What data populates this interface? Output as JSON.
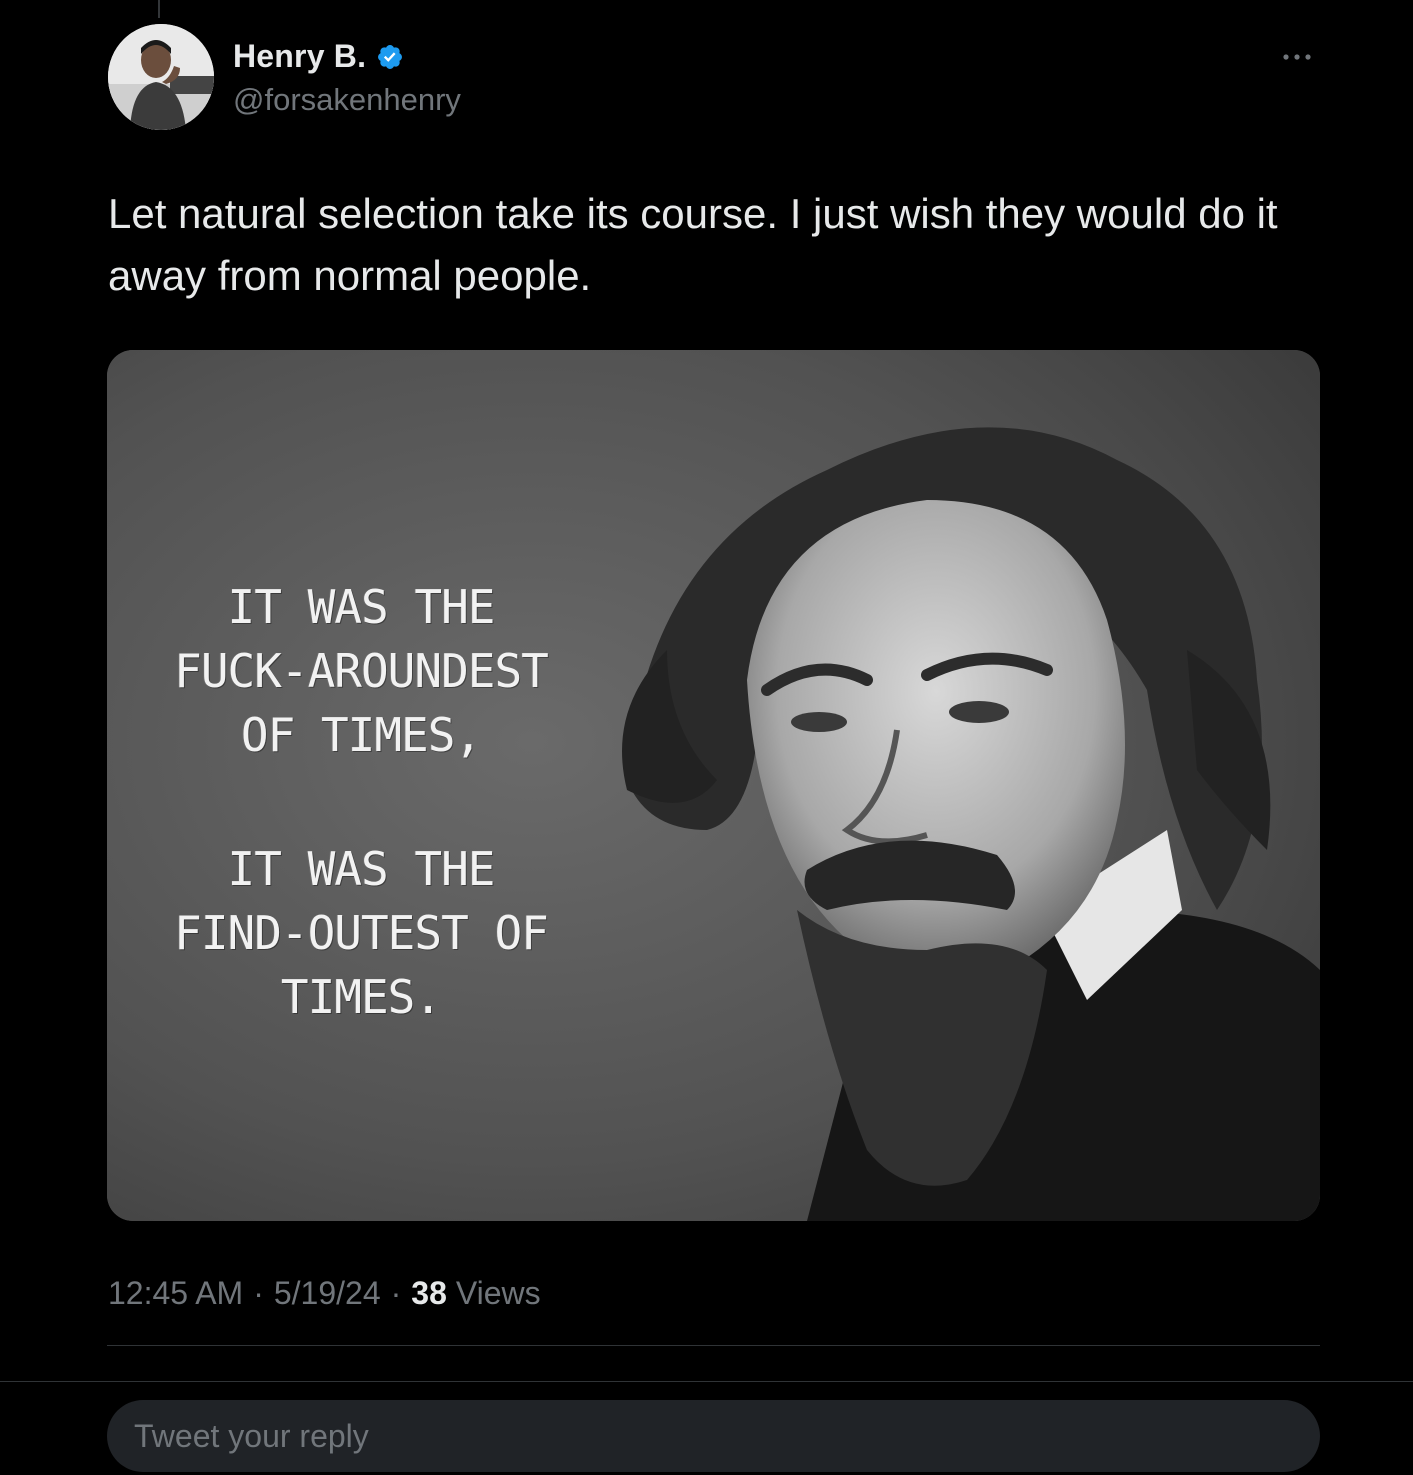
{
  "author": {
    "display_name": "Henry B.",
    "handle": "@forsakenhenry",
    "verified": true,
    "verified_color": "#1d9bf0",
    "avatar_icon": "profile-photo"
  },
  "tweet": {
    "text": "Let natural selection take its course. I just wish they would do it away from normal people.",
    "media": {
      "kind": "meme-image",
      "quote_line_1": "IT WAS THE\nFUCK-AROUNDEST\nOF TIMES,",
      "quote_line_2": "IT WAS THE\nFIND-OUTEST OF\nTIMES."
    },
    "time": "12:45 AM",
    "date": "5/19/24",
    "views_count": "38",
    "views_label": "Views",
    "separator": "·"
  },
  "reply": {
    "placeholder": "Tweet your reply"
  },
  "colors": {
    "background": "#000000",
    "text_primary": "#e7e9ea",
    "text_secondary": "#71767b",
    "divider": "#2f3336",
    "reply_box": "#202327"
  }
}
